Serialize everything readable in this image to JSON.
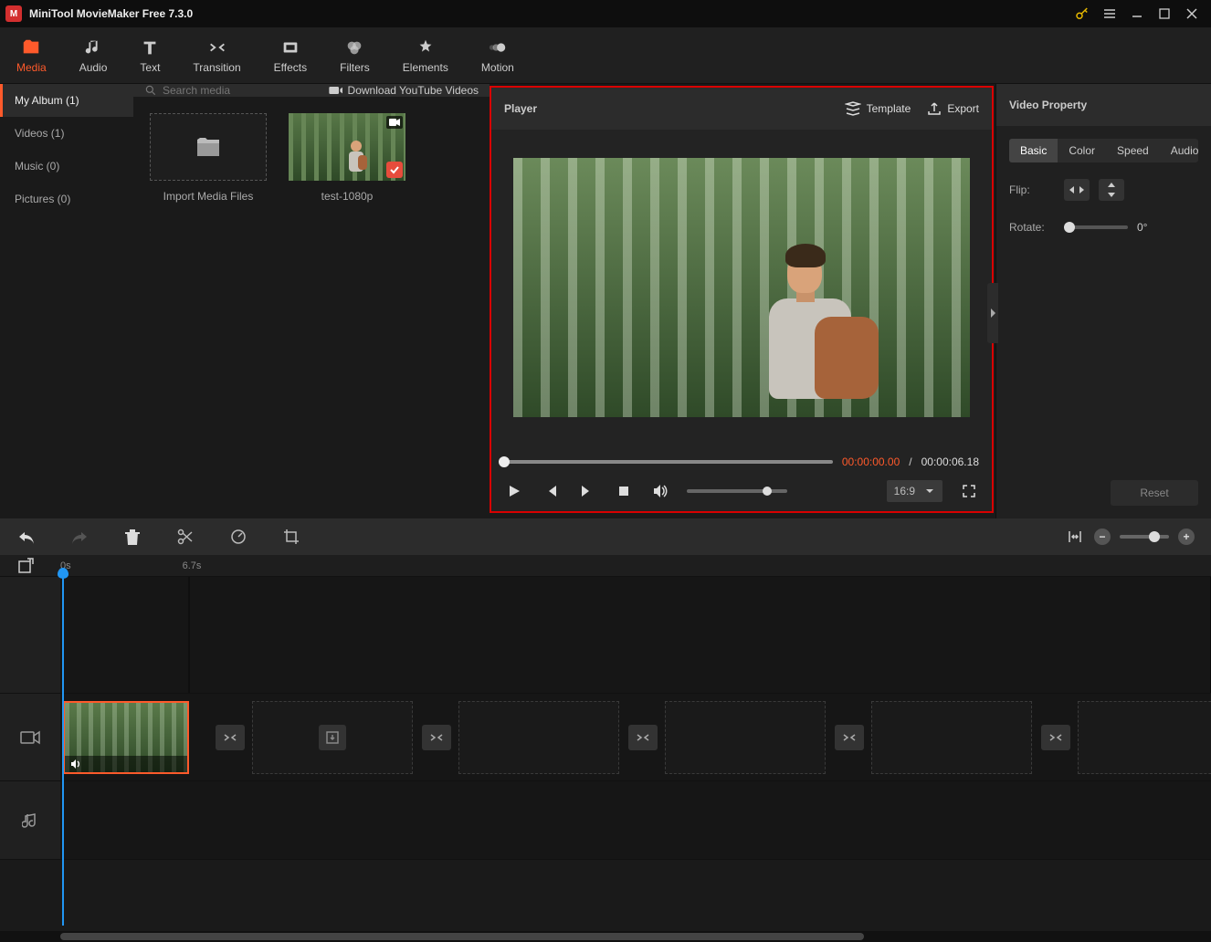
{
  "titlebar": {
    "title": "MiniTool MovieMaker Free 7.3.0"
  },
  "ribbon": {
    "tabs": [
      {
        "label": "Media"
      },
      {
        "label": "Audio"
      },
      {
        "label": "Text"
      },
      {
        "label": "Transition"
      },
      {
        "label": "Effects"
      },
      {
        "label": "Filters"
      },
      {
        "label": "Elements"
      },
      {
        "label": "Motion"
      }
    ]
  },
  "album": {
    "items": [
      {
        "label": "My Album (1)"
      },
      {
        "label": "Videos (1)"
      },
      {
        "label": "Music (0)"
      },
      {
        "label": "Pictures (0)"
      }
    ]
  },
  "media": {
    "search_placeholder": "Search media",
    "download_label": "Download YouTube Videos",
    "import_label": "Import Media Files",
    "clips": [
      {
        "name": "test-1080p"
      }
    ]
  },
  "player": {
    "title": "Player",
    "template_label": "Template",
    "export_label": "Export",
    "time_current": "00:00:00.00",
    "time_separator": " / ",
    "time_total": "00:00:06.18",
    "aspect": "16:9"
  },
  "property": {
    "title": "Video Property",
    "tabs": [
      {
        "label": "Basic"
      },
      {
        "label": "Color"
      },
      {
        "label": "Speed"
      },
      {
        "label": "Audio"
      }
    ],
    "flip_label": "Flip:",
    "rotate_label": "Rotate:",
    "rotate_value": "0°",
    "reset_label": "Reset"
  },
  "timeline": {
    "ticks": [
      "0s",
      "6.7s"
    ]
  }
}
